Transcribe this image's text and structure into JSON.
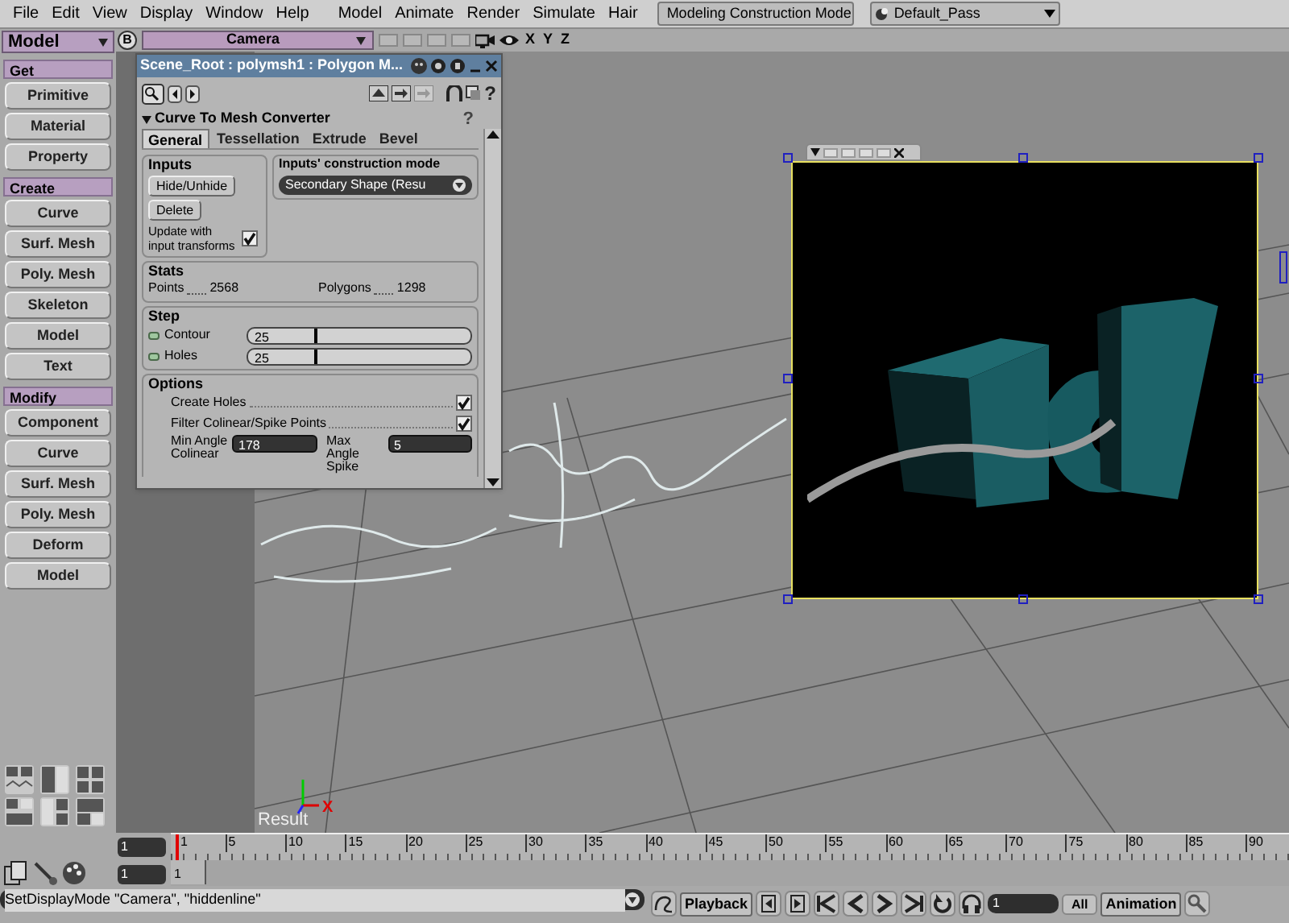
{
  "menu_bar": {
    "items": [
      "File",
      "Edit",
      "View",
      "Display",
      "Window",
      "Help"
    ],
    "modules": [
      "Model",
      "Animate",
      "Render",
      "Simulate",
      "Hair"
    ],
    "mode_dropdown": "Modeling Construction Mode",
    "pass_dropdown": "Default_Pass"
  },
  "toolbar": {
    "title": "Model",
    "sections": [
      {
        "header": "Get",
        "buttons": [
          "Primitive",
          "Material",
          "Property"
        ]
      },
      {
        "header": "Create",
        "buttons": [
          "Curve",
          "Surf. Mesh",
          "Poly. Mesh",
          "Skeleton",
          "Model",
          "Text"
        ]
      },
      {
        "header": "Modify",
        "buttons": [
          "Component",
          "Curve",
          "Surf. Mesh",
          "Poly. Mesh",
          "Deform",
          "Model"
        ]
      }
    ]
  },
  "viewport": {
    "view_letter": "B",
    "camera": "Camera",
    "axis_toggles": [
      "X",
      "Y",
      "Z"
    ],
    "gizmo_label": "X",
    "label": "Result"
  },
  "property_editor": {
    "title": "Scene_Root : polymsh1 : Polygon M...",
    "toolbar_help": "?",
    "section": "Curve To Mesh Converter",
    "section_help": "?",
    "tabs": [
      {
        "label": "General",
        "selected": true
      },
      {
        "label": "Tessellation",
        "selected": false
      },
      {
        "label": "Extrude",
        "selected": false
      },
      {
        "label": "Bevel",
        "selected": false
      }
    ],
    "inputs": {
      "title": "Inputs",
      "buttons": [
        "Hide/Unhide",
        "Delete"
      ],
      "update_label": "Update with input transforms",
      "update_checked": true
    },
    "construction_mode": {
      "title": "Inputs' construction mode",
      "value": "Secondary Shape (Resu"
    },
    "stats": {
      "title": "Stats",
      "items": [
        {
          "label": "Points",
          "value": "2568"
        },
        {
          "label": "Polygons",
          "value": "1298"
        }
      ]
    },
    "step": {
      "title": "Step",
      "sliders": [
        {
          "label": "Contour",
          "value": "25",
          "level": 0.3
        },
        {
          "label": "Holes",
          "value": "25",
          "level": 0.3
        }
      ]
    },
    "options": {
      "title": "Options",
      "checkboxes": [
        {
          "label": "Create Holes",
          "checked": true
        },
        {
          "label": "Filter Colinear/Spike Points",
          "checked": true
        }
      ],
      "fields": [
        {
          "label": "Min Angle Colinear",
          "value": "178"
        },
        {
          "label": "Max Angle Spike",
          "value": "5"
        }
      ]
    }
  },
  "timeline": {
    "start_frame": "1",
    "end_frame": "1",
    "range_marker": "1",
    "ticks": [
      "1",
      "5",
      "10",
      "15",
      "20",
      "25",
      "30",
      "35",
      "40",
      "45",
      "50",
      "55",
      "60",
      "65",
      "70",
      "75",
      "80",
      "85",
      "90"
    ]
  },
  "command_line": "SetDisplayMode \"Camera\", \"hiddenline\"",
  "playback": {
    "label": "Playback",
    "frame": "1",
    "all": "All",
    "animation": "Animation"
  }
}
